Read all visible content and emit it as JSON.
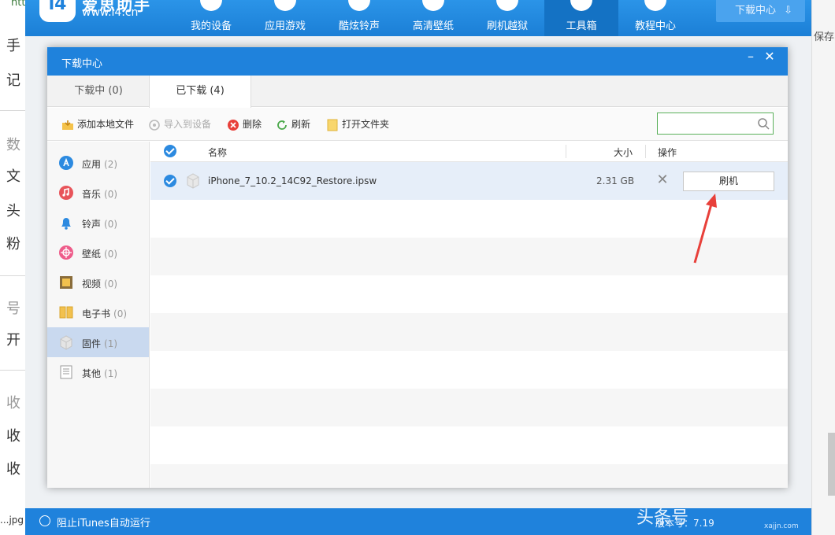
{
  "app": {
    "logo_name": "爱思助手",
    "logo_url": "www.i4.cn",
    "nav": [
      {
        "label": "我的设备"
      },
      {
        "label": "应用游戏"
      },
      {
        "label": "酷炫铃声"
      },
      {
        "label": "高清壁纸"
      },
      {
        "label": "刷机越狱"
      },
      {
        "label": "工具箱"
      },
      {
        "label": "教程中心"
      }
    ],
    "download_center_btn": "下载中心",
    "status": {
      "itunes_block_label": "阻止iTunes自动运行",
      "version_fragment": "版本号：7.19"
    }
  },
  "background": {
    "save_label": "保存",
    "left_fragments": [
      "手",
      "记",
      "数",
      "文",
      "头",
      "粉",
      "号",
      "开",
      "收",
      "收",
      "收"
    ],
    "bottom_file": "...jpg",
    "url_fragment": "htt"
  },
  "watermark": {
    "text": "头条号",
    "site": "xajjn.com"
  },
  "dialog": {
    "title": "下载中心",
    "tabs": [
      {
        "label": "下载中 (0)"
      },
      {
        "label": "已下载 (4)"
      }
    ],
    "toolbar": {
      "add_local": "添加本地文件",
      "import_device": "导入到设备",
      "delete": "删除",
      "refresh": "刷新",
      "open_folder": "打开文件夹",
      "search_placeholder": ""
    },
    "categories": [
      {
        "label": "应用",
        "count": "(2)",
        "color": "#2c8ae0"
      },
      {
        "label": "音乐",
        "count": "(0)",
        "color": "#e8545a"
      },
      {
        "label": "铃声",
        "count": "(0)",
        "color": "#2c8ae0"
      },
      {
        "label": "壁纸",
        "count": "(0)",
        "color": "#ee5c8a"
      },
      {
        "label": "视频",
        "count": "(0)",
        "color": "#8a6d3b"
      },
      {
        "label": "电子书",
        "count": "(0)",
        "color": "#f2c14e"
      },
      {
        "label": "固件",
        "count": "(1)",
        "color": "#cfcfcf"
      },
      {
        "label": "其他",
        "count": "(1)",
        "color": "#9a9a9a"
      }
    ],
    "list": {
      "col_name": "名称",
      "col_size": "大小",
      "col_action": "操作",
      "rows": [
        {
          "name": "iPhone_7_10.2_14C92_Restore.ipsw",
          "size": "2.31 GB",
          "action": "刷机"
        }
      ]
    }
  },
  "colors": {
    "primary": "#1f82dc",
    "accent_arrow": "#e8403a",
    "search_border": "#5ab05a"
  }
}
